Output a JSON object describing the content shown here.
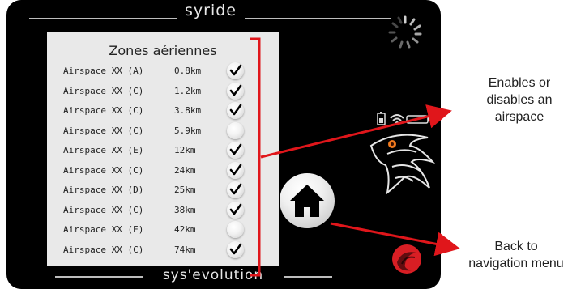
{
  "brand": {
    "top": "syride",
    "bottom": "sys'evolution"
  },
  "screen": {
    "title": "Zones aériennes",
    "rows": [
      {
        "name": "Airspace XX (A)",
        "distance": "0.8km",
        "checked": true
      },
      {
        "name": "Airspace XX (C)",
        "distance": "1.2km",
        "checked": true
      },
      {
        "name": "Airspace XX (C)",
        "distance": "3.8km",
        "checked": true
      },
      {
        "name": "Airspace XX (C)",
        "distance": "5.9km",
        "checked": false
      },
      {
        "name": "Airspace XX (E)",
        "distance": "12km",
        "checked": true
      },
      {
        "name": "Airspace XX (C)",
        "distance": "24km",
        "checked": true
      },
      {
        "name": "Airspace XX (D)",
        "distance": "25km",
        "checked": true
      },
      {
        "name": "Airspace XX (C)",
        "distance": "38km",
        "checked": true
      },
      {
        "name": "Airspace XX (E)",
        "distance": "42km",
        "checked": false
      },
      {
        "name": "Airspace XX (C)",
        "distance": "74km",
        "checked": true
      }
    ]
  },
  "home_button": {
    "icon": "home-icon"
  },
  "annotations": {
    "toggle": "Enables or disables an airspace",
    "toggle_lines": [
      "Enables or",
      "disables an",
      "airspace"
    ],
    "back_lines": [
      "Back to",
      "navigation menu"
    ]
  },
  "colors": {
    "device": "#000000",
    "screen": "#e9e9e9",
    "annotation_arrow": "#e0161b",
    "accent_red": "#d81e24"
  }
}
